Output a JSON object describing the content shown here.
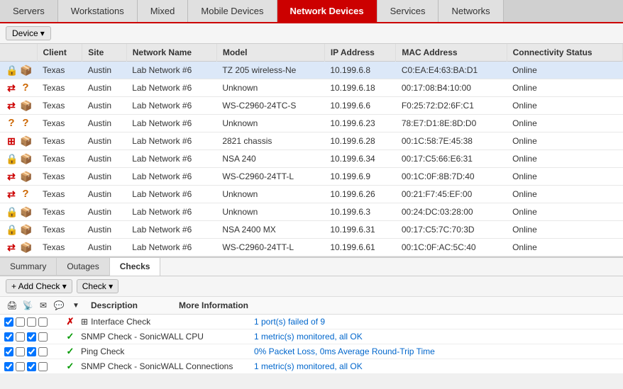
{
  "tabs": [
    {
      "label": "Servers",
      "active": false
    },
    {
      "label": "Workstations",
      "active": false
    },
    {
      "label": "Mixed",
      "active": false
    },
    {
      "label": "Mobile Devices",
      "active": false
    },
    {
      "label": "Network Devices",
      "active": true
    },
    {
      "label": "Services",
      "active": false
    },
    {
      "label": "Networks",
      "active": false
    }
  ],
  "toolbar": {
    "device_label": "Device",
    "dropdown_arrow": "▾"
  },
  "table": {
    "columns": [
      "",
      "Client",
      "Site",
      "Network Name",
      "Model",
      "IP Address",
      "MAC Address",
      "Connectivity Status"
    ],
    "rows": [
      {
        "icon1": "🔒",
        "icon2": "📦",
        "icon1_class": "icon-red",
        "icon2_class": "icon-cube",
        "client": "Texas",
        "site": "Austin",
        "network": "Lab Network #6",
        "model": "TZ 205 wireless-Ne",
        "ip": "10.199.6.8",
        "mac": "C0:EA:E4:63:BA:D1",
        "status": "Online"
      },
      {
        "icon1": "↔",
        "icon2": "?",
        "icon1_class": "icon-red",
        "icon2_class": "icon-question",
        "client": "Texas",
        "site": "Austin",
        "network": "Lab Network #6",
        "model": "Unknown",
        "ip": "10.199.6.18",
        "mac": "00:17:08:B4:10:00",
        "status": "Online"
      },
      {
        "icon1": "↔",
        "icon2": "📦",
        "icon1_class": "icon-red",
        "icon2_class": "icon-cube",
        "client": "Texas",
        "site": "Austin",
        "network": "Lab Network #6",
        "model": "WS-C2960-24TC-S",
        "ip": "10.199.6.6",
        "mac": "F0:25:72:D2:6F:C1",
        "status": "Online"
      },
      {
        "icon1": "?",
        "icon2": "?",
        "icon1_class": "icon-question",
        "icon2_class": "icon-question",
        "client": "Texas",
        "site": "Austin",
        "network": "Lab Network #6",
        "model": "Unknown",
        "ip": "10.199.6.23",
        "mac": "78:E7:D1:8E:8D:D0",
        "status": "Online"
      },
      {
        "icon1": "⊞",
        "icon2": "📦",
        "icon1_class": "icon-red",
        "icon2_class": "icon-cube",
        "client": "Texas",
        "site": "Austin",
        "network": "Lab Network #6",
        "model": "2821 chassis",
        "ip": "10.199.6.28",
        "mac": "00:1C:58:7E:45:38",
        "status": "Online"
      },
      {
        "icon1": "🔒",
        "icon2": "📦",
        "icon1_class": "icon-red",
        "icon2_class": "icon-cube",
        "client": "Texas",
        "site": "Austin",
        "network": "Lab Network #6",
        "model": "NSA 240",
        "ip": "10.199.6.34",
        "mac": "00:17:C5:66:E6:31",
        "status": "Online"
      },
      {
        "icon1": "↔",
        "icon2": "📦",
        "icon1_class": "icon-red",
        "icon2_class": "icon-cube",
        "client": "Texas",
        "site": "Austin",
        "network": "Lab Network #6",
        "model": "WS-C2960-24TT-L",
        "ip": "10.199.6.9",
        "mac": "00:1C:0F:8B:7D:40",
        "status": "Online"
      },
      {
        "icon1": "↔",
        "icon2": "?",
        "icon1_class": "icon-red",
        "icon2_class": "icon-question",
        "client": "Texas",
        "site": "Austin",
        "network": "Lab Network #6",
        "model": "Unknown",
        "ip": "10.199.6.26",
        "mac": "00:21:F7:45:EF:00",
        "status": "Online"
      },
      {
        "icon1": "🔒",
        "icon2": "📦",
        "icon1_class": "icon-red",
        "icon2_class": "icon-cube",
        "client": "Texas",
        "site": "Austin",
        "network": "Lab Network #6",
        "model": "Unknown",
        "ip": "10.199.6.3",
        "mac": "00:24:DC:03:28:00",
        "status": "Online"
      },
      {
        "icon1": "🔒",
        "icon2": "📦",
        "icon1_class": "icon-red",
        "icon2_class": "icon-cube",
        "client": "Texas",
        "site": "Austin",
        "network": "Lab Network #6",
        "model": "NSA 2400 MX",
        "ip": "10.199.6.31",
        "mac": "00:17:C5:7C:70:3D",
        "status": "Online"
      },
      {
        "icon1": "↔",
        "icon2": "📦",
        "icon1_class": "icon-red",
        "icon2_class": "icon-cube",
        "client": "Texas",
        "site": "Austin",
        "network": "Lab Network #6",
        "model": "WS-C2960-24TT-L",
        "ip": "10.199.6.61",
        "mac": "00:1C:0F:AC:5C:40",
        "status": "Online"
      }
    ]
  },
  "bottom_tabs": [
    {
      "label": "Summary",
      "active": false
    },
    {
      "label": "Outages",
      "active": false
    },
    {
      "label": "Checks",
      "active": true
    }
  ],
  "checks_toolbar": {
    "add_check": "+ Add Check",
    "check": "Check",
    "dropdown": "▾"
  },
  "checks_icons": [
    "🖨",
    "📡",
    "✉",
    "💬"
  ],
  "checks": {
    "columns": [
      "Description",
      "More Information"
    ],
    "rows": [
      {
        "status": "x",
        "desc_icon": "⊞",
        "description": "Interface Check",
        "more_info": "1 port(s) failed of 9",
        "info_link": true
      },
      {
        "status": "check",
        "desc_icon": "",
        "description": "SNMP Check - SonicWALL CPU",
        "more_info": "1 metric(s) monitored, all OK",
        "info_link": true
      },
      {
        "status": "check",
        "desc_icon": "",
        "description": "Ping Check",
        "more_info": "0% Packet Loss, 0ms Average Round-Trip Time",
        "info_link": true
      },
      {
        "status": "check",
        "desc_icon": "",
        "description": "SNMP Check - SonicWALL Connections",
        "more_info": "1 metric(s) monitored, all OK",
        "info_link": true
      }
    ]
  }
}
